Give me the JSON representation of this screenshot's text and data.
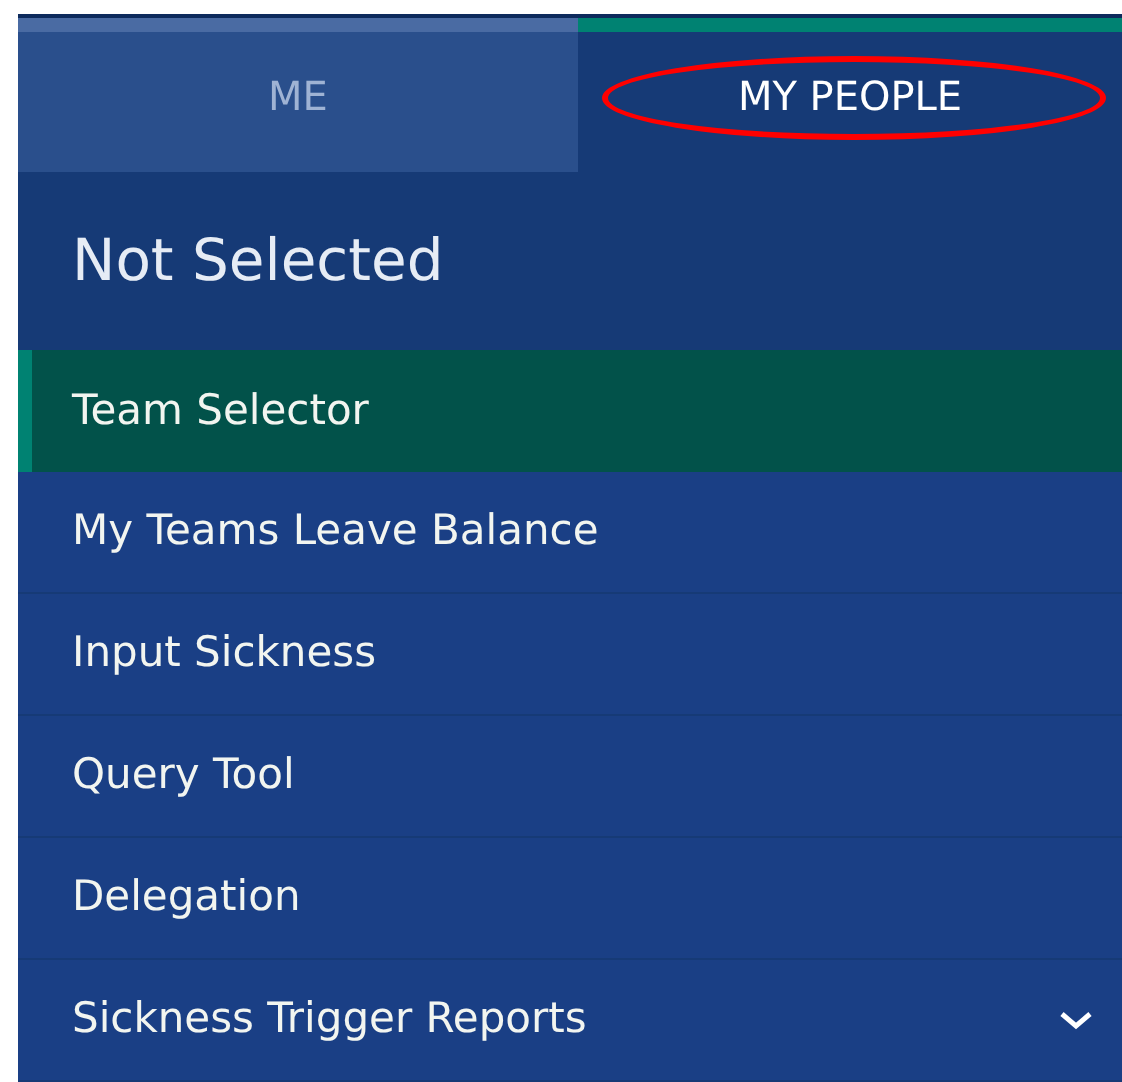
{
  "tabs": [
    {
      "label": "ME",
      "selected": false,
      "circled": false
    },
    {
      "label": "MY PEOPLE",
      "selected": true,
      "circled": true
    }
  ],
  "header": {
    "title": "Not Selected"
  },
  "menu": {
    "items": [
      {
        "label": "Team Selector",
        "selected": true,
        "expandable": false
      },
      {
        "label": "My Teams Leave Balance",
        "selected": false,
        "expandable": false
      },
      {
        "label": "Input Sickness",
        "selected": false,
        "expandable": false
      },
      {
        "label": "Query Tool",
        "selected": false,
        "expandable": false
      },
      {
        "label": "Delegation",
        "selected": false,
        "expandable": false
      },
      {
        "label": "Sickness Trigger Reports",
        "selected": false,
        "expandable": true
      }
    ]
  }
}
